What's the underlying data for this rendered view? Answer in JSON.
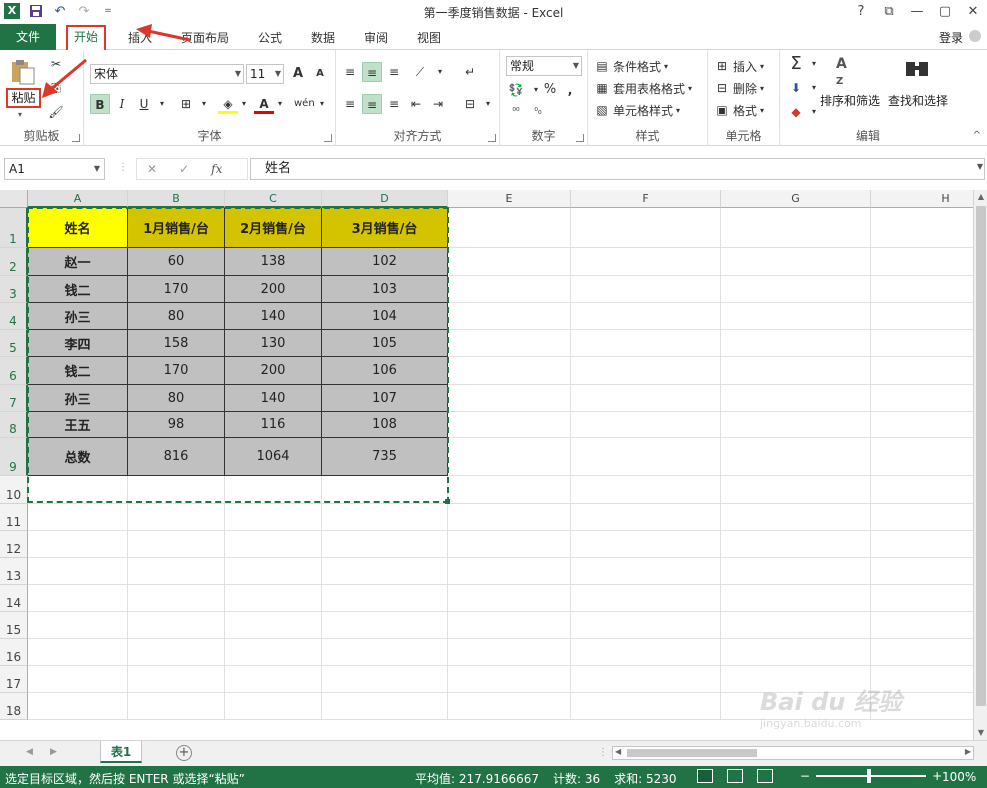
{
  "window": {
    "title": "第一季度销售数据 - Excel",
    "buttons": [
      "?",
      "⧉",
      "—",
      "▢",
      "✕"
    ]
  },
  "quick_access": {
    "undo": "↶",
    "redo": "↷",
    "more": "="
  },
  "tabs": {
    "file": "文件",
    "home": "开始",
    "insert": "插入",
    "page_layout": "页面布局",
    "formulas": "公式",
    "data": "数据",
    "review": "审阅",
    "view": "视图",
    "login": "登录"
  },
  "ribbon": {
    "clipboard": {
      "label": "剪贴板",
      "paste": "粘贴"
    },
    "font": {
      "label": "字体",
      "name": "宋体",
      "size": "11",
      "grow": "A",
      "shrink": "A",
      "bold": "B",
      "italic": "I",
      "underline": "U",
      "phonetic": "wén"
    },
    "alignment": {
      "label": "对齐方式"
    },
    "number": {
      "label": "数字",
      "format": "常规",
      "percent": "%",
      "comma": ","
    },
    "styles": {
      "label": "样式",
      "conditional": "条件格式",
      "table": "套用表格格式",
      "cell_styles": "单元格样式"
    },
    "cells": {
      "label": "单元格",
      "insert": "插入",
      "delete": "删除",
      "format": "格式"
    },
    "editing": {
      "label": "编辑",
      "sort": "排序和筛选",
      "find": "查找和选择"
    }
  },
  "formula_bar": {
    "name_box": "A1",
    "fx": "fx",
    "content": "姓名"
  },
  "columns": [
    "A",
    "B",
    "C",
    "D",
    "E",
    "F",
    "G",
    "H"
  ],
  "rows": [
    "1",
    "2",
    "3",
    "4",
    "5",
    "6",
    "7",
    "8",
    "9",
    "10",
    "11",
    "12",
    "13",
    "14",
    "15",
    "16",
    "17",
    "18"
  ],
  "table": {
    "headers": [
      "姓名",
      "1月销售/台",
      "2月销售/台",
      "3月销售/台"
    ],
    "rows": [
      [
        "赵一",
        "60",
        "138",
        "102"
      ],
      [
        "钱二",
        "170",
        "200",
        "103"
      ],
      [
        "孙三",
        "80",
        "140",
        "104"
      ],
      [
        "李四",
        "158",
        "130",
        "105"
      ],
      [
        "钱二",
        "170",
        "200",
        "106"
      ],
      [
        "孙三",
        "80",
        "140",
        "107"
      ],
      [
        "王五",
        "98",
        "116",
        "108"
      ],
      [
        "总数",
        "816",
        "1064",
        "735"
      ]
    ]
  },
  "sheet": {
    "tab": "表1",
    "add": "+"
  },
  "status": {
    "message": "选定目标区域，然后按 ENTER 或选择“粘贴”",
    "average": "平均值: 217.9166667",
    "count": "计数: 36",
    "sum": "求和: 5230",
    "zoom": "100%",
    "zoom_minus": "−",
    "zoom_plus": "+"
  },
  "watermark": {
    "brand": "Bai du 经验",
    "url": "jingyan.baidu.com"
  },
  "colors": {
    "excel_green": "#217346",
    "annotation_red": "#d9382a",
    "header_fill": "#d4c400",
    "header_a_fill": "#ffff00",
    "data_fill": "#c0c0c0"
  }
}
